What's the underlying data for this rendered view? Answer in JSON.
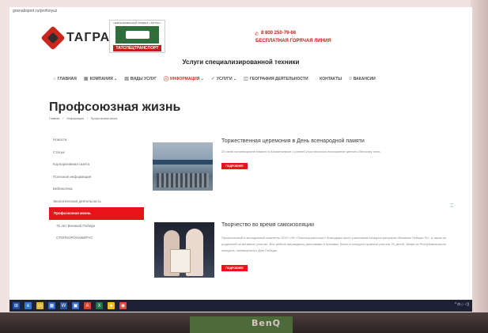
{
  "url": "gosnabsport.ru/profsoyuz",
  "header": {
    "brand": "ТАГРАС",
    "logo2_top": "НЕФТЕСЕРВИСНЫЙ ХОЛДИНГ «ТАГРАС»",
    "logo2_name": "ТАТСПЕЦТРАНСПОРТ",
    "phone": "8 800 250-79-66",
    "hotline": "БЕСПЛАТНАЯ ГОРЯЧАЯ ЛИНИЯ",
    "services_title": "Услуги специализированной техники"
  },
  "nav": [
    {
      "icon": "⌂",
      "label": "ГЛАВНАЯ"
    },
    {
      "icon": "▣",
      "label": "КОМПАНИЯ ⌄"
    },
    {
      "icon": "▤",
      "label": "ВИДЫ УСЛУГ"
    },
    {
      "icon": "ⓘ",
      "label": "ИНФОРМАЦИЯ ⌄"
    },
    {
      "icon": "✓",
      "label": "УСЛУГИ ⌄"
    },
    {
      "icon": "◫",
      "label": "ГЕОГРАФИЯ ДЕЯТЕЛЬНОСТИ"
    },
    {
      "icon": "◌",
      "label": "КОНТАКТЫ"
    },
    {
      "icon": "≡",
      "label": "ВАКАНСИИ"
    }
  ],
  "page": {
    "title": "Профсоюзная жизнь",
    "breadcrumb": [
      "Главная",
      "/",
      "Информация",
      "/",
      "Профсоюзная жизнь"
    ]
  },
  "sidebar": [
    "Новости",
    "Статьи",
    "Корпоративная газета",
    "Полезная информация",
    "Библиотека",
    "Экологическая деятельность",
    "Профсоюзная жизнь",
    "75 лет Великой Победе",
    "СТОПКОРОНАВИРУС"
  ],
  "posts": [
    {
      "title": "Торжественная церемония в День всенародной памяти",
      "text": "22 июня на мемориале памяти в Альметьевске с ранней утра началось возложение цветов к Вечному огню.",
      "button": "ПОДРОБНЕЕ"
    },
    {
      "title": "Творчество во время самоизоляции",
      "text": "Профсоюзный и молодежный комитеты ООО «УК «Татспецтранспорт» благодарят всех участников конкурса рисунков «Великая Победа-75», а также их родителей за активное участие. Все ребята награждены дипломами и призами. Всего в конкурсе приняли участие 20 детей. Жюри из Республиканского конкурса, посвященного Дню Победы.",
      "button": "ПОДРОБНЕЕ"
    }
  ],
  "taskbar": {
    "tray": "^ ◘ ⌂ ◁)"
  },
  "monitor_brand": "BenQ"
}
